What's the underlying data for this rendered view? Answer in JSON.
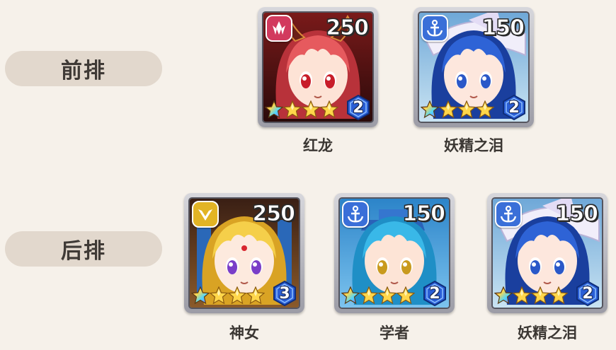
{
  "rows": {
    "front_label": "前排",
    "back_label": "后排"
  },
  "heroes": [
    {
      "name": "红龙",
      "power": "250",
      "level": "2",
      "stars": 4,
      "element": "flame",
      "element_icon": "crystal-icon",
      "badge_color": "#d23a5e",
      "theme": "red"
    },
    {
      "name": "妖精之泪",
      "power": "150",
      "level": "2",
      "stars": 4,
      "element": "water",
      "element_icon": "anchor-icon",
      "badge_color": "#3a6fd8",
      "theme": "fairy"
    },
    {
      "name": "神女",
      "power": "250",
      "level": "3",
      "stars": 4,
      "element": "holy",
      "element_icon": "wings-icon",
      "badge_color": "#e2b425",
      "theme": "goddess"
    },
    {
      "name": "学者",
      "power": "150",
      "level": "2",
      "stars": 4,
      "element": "water",
      "element_icon": "anchor-icon",
      "badge_color": "#3a6fd8",
      "theme": "scholar"
    },
    {
      "name": "妖精之泪",
      "power": "150",
      "level": "2",
      "stars": 4,
      "element": "water",
      "element_icon": "anchor-icon",
      "badge_color": "#3a6fd8",
      "theme": "fairy"
    }
  ]
}
